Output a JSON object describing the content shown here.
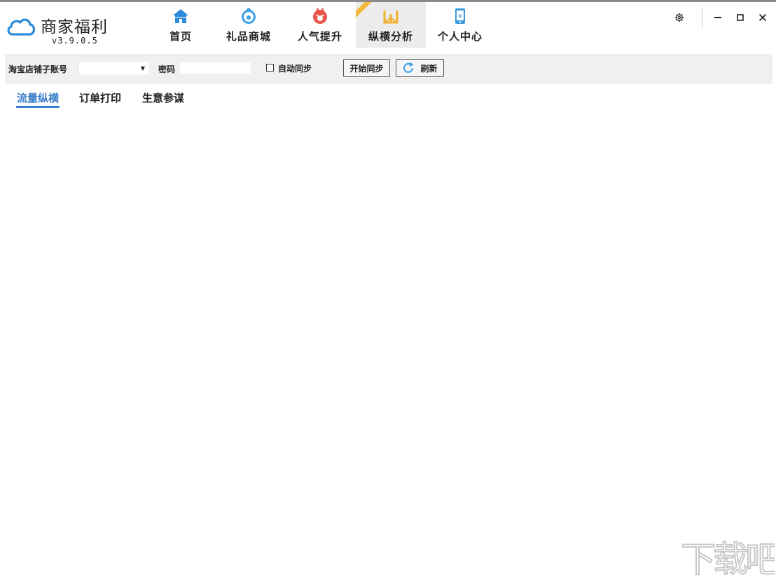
{
  "app": {
    "name": "商家福利",
    "version": "v3.9.0.5",
    "accent_color": "#3a7fc9"
  },
  "nav": [
    {
      "label": "首页",
      "icon": "home-icon",
      "color": "#2d8ad8"
    },
    {
      "label": "礼品商城",
      "icon": "gift-bag-icon",
      "color": "#3aa0e8"
    },
    {
      "label": "人气提升",
      "icon": "piggy-icon",
      "color": "#e8564a"
    },
    {
      "label": "纵横分析",
      "icon": "chart-w-icon",
      "color": "#f2b02f",
      "active": true
    },
    {
      "label": "个人中心",
      "icon": "phone-yen-icon",
      "color": "#3a9be0"
    }
  ],
  "toolbar": {
    "shop_account_label": "淘宝店铺子账号",
    "shop_account_value": "",
    "password_label": "密码",
    "password_value": "",
    "auto_sync_label": "自动同步",
    "auto_sync_checked": false,
    "start_sync_label": "开始同步",
    "refresh_label": "刷新"
  },
  "tabs": [
    {
      "label": "流量纵横",
      "active": true
    },
    {
      "label": "订单打印"
    },
    {
      "label": "生意参谋"
    }
  ],
  "watermark": "下载吧"
}
